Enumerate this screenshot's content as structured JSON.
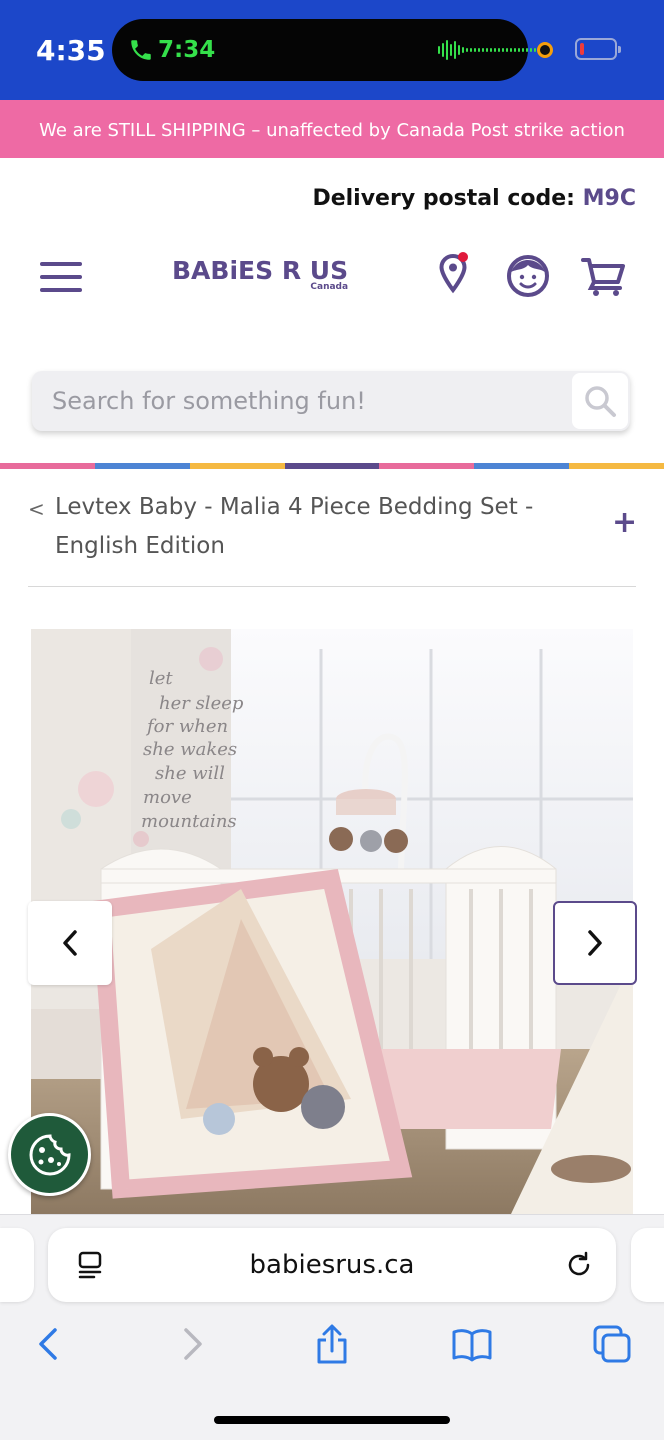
{
  "status_bar": {
    "time": "4:35",
    "call_time": "7:34",
    "battery_level_fraction": 0.12,
    "colors": {
      "background": "#1c47c9",
      "call_green": "#35e04b"
    },
    "icons": [
      "phone-icon",
      "waveform-icon",
      "camera-dot-icon",
      "battery-icon"
    ]
  },
  "promo": {
    "text": "We are STILL SHIPPING – unaffected by Canada Post strike action"
  },
  "delivery": {
    "label": "Delivery postal code:",
    "code": "M9C"
  },
  "header": {
    "logo_text": "BABiES R US",
    "logo_sub": "Canada",
    "icons": [
      "menu-icon",
      "location-pin-icon",
      "account-face-icon",
      "cart-icon"
    ],
    "brand_color": "#5b4a8b"
  },
  "search": {
    "placeholder": "Search for something fun!",
    "icon": "search-icon"
  },
  "stripe_colors": [
    "#e86b9b",
    "#4d84d4",
    "#f5b942",
    "#5b4a8b",
    "#e86b9b",
    "#4d84d4",
    "#f5b942"
  ],
  "product": {
    "back_symbol": "<",
    "title": "Levtex Baby - Malia 4 Piece Bedding Set - English Edition",
    "expand_symbol": "+",
    "image": {
      "description_icons": [
        "chevron-left-icon",
        "chevron-right-icon"
      ],
      "wall_text": [
        "let",
        "her sleep",
        "for when",
        "she wakes",
        "she will",
        "move",
        "mountains"
      ]
    }
  },
  "cookie": {
    "icon": "cookie-icon"
  },
  "browser": {
    "url": "babiesrus.ca",
    "icons": [
      "reader-icon",
      "reload-icon",
      "back-icon",
      "forward-icon",
      "share-icon",
      "bookmarks-icon",
      "tabs-icon"
    ]
  }
}
